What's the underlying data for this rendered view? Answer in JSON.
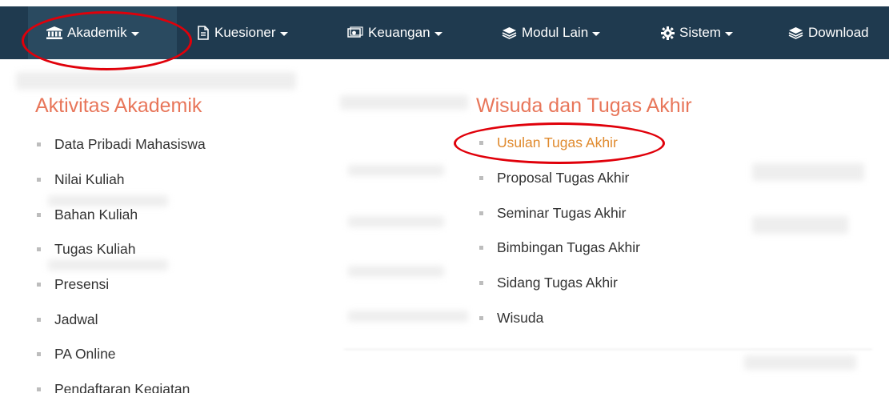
{
  "navbar": {
    "items": [
      {
        "label": "Akademik",
        "icon": "university-icon"
      },
      {
        "label": "Kuesioner",
        "icon": "document-icon"
      },
      {
        "label": "Keuangan",
        "icon": "money-icon"
      },
      {
        "label": "Modul Lain",
        "icon": "layers-icon"
      },
      {
        "label": "Sistem",
        "icon": "gear-icon"
      },
      {
        "label": "Download",
        "icon": "layers-icon"
      }
    ]
  },
  "dropdown": {
    "left_column": {
      "title": "Aktivitas Akademik",
      "items": [
        "Data Pribadi Mahasiswa",
        "Nilai Kuliah",
        "Bahan Kuliah",
        "Tugas Kuliah",
        "Presensi",
        "Jadwal",
        "PA Online",
        "Pendaftaran Kegiatan"
      ]
    },
    "right_column": {
      "title": "Wisuda dan Tugas Akhir",
      "items": [
        "Usulan Tugas Akhir",
        "Proposal Tugas Akhir",
        "Seminar Tugas Akhir",
        "Bimbingan Tugas Akhir",
        "Sidang Tugas Akhir",
        "Wisuda"
      ]
    }
  },
  "colors": {
    "navbar_bg": "#1f3a4f",
    "navbar_active_bg": "#2a4a60",
    "section_title": "#e8765a",
    "highlight_link": "#e08a2e",
    "annotation_red": "#e0000a"
  }
}
